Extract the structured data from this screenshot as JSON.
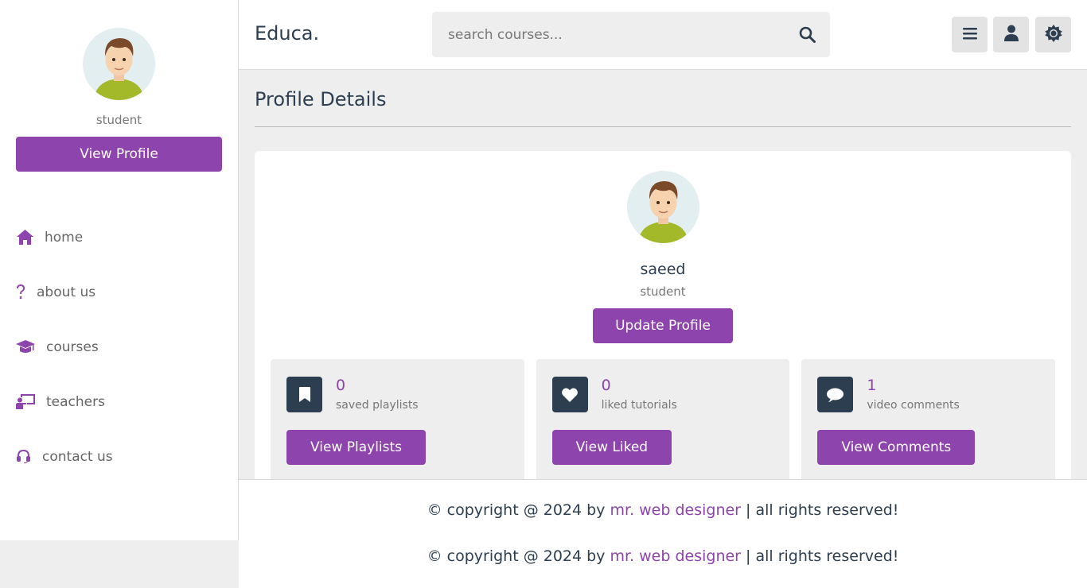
{
  "sidebar": {
    "role": "student",
    "view_profile_label": "View Profile",
    "nav": [
      {
        "label": "home",
        "icon": "home-icon"
      },
      {
        "label": "about us",
        "icon": "question-icon"
      },
      {
        "label": "courses",
        "icon": "graduation-cap-icon"
      },
      {
        "label": "teachers",
        "icon": "teacher-icon"
      },
      {
        "label": "contact us",
        "icon": "headset-icon"
      }
    ]
  },
  "header": {
    "logo": "Educa.",
    "search_placeholder": "search courses..."
  },
  "main": {
    "title": "Profile Details",
    "profile": {
      "name": "saeed",
      "role": "student",
      "update_label": "Update Profile"
    },
    "stats": [
      {
        "count": "0",
        "label": "saved playlists",
        "button": "View Playlists",
        "icon": "bookmark-icon"
      },
      {
        "count": "0",
        "label": "liked tutorials",
        "button": "View Liked",
        "icon": "heart-icon"
      },
      {
        "count": "1",
        "label": "video comments",
        "button": "View Comments",
        "icon": "comment-icon"
      }
    ]
  },
  "footer": {
    "prefix": "© copyright @ 2024 by ",
    "author": "mr. web designer",
    "suffix": " | all rights reserved!"
  },
  "colors": {
    "accent": "#8e44ad",
    "dark": "#2c3e50",
    "background": "#eeeeee"
  }
}
